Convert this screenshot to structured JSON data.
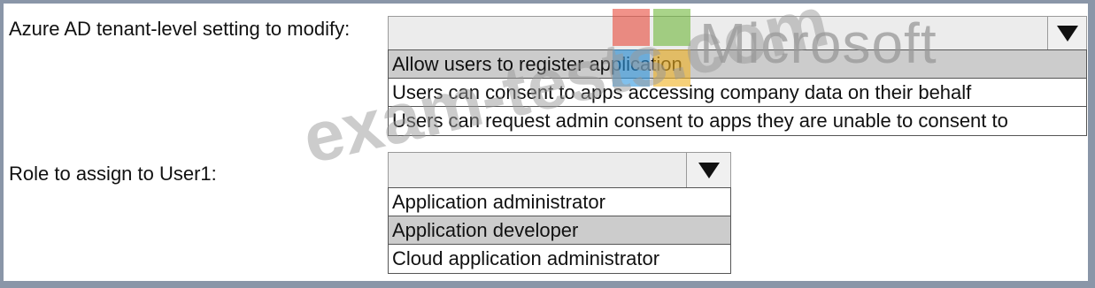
{
  "question1": {
    "label": "Azure AD tenant-level setting to modify:",
    "selected": "",
    "options": [
      "Allow users to register application",
      "Users can consent to apps accessing company data on their behalf",
      "Users can request admin consent to apps they are unable to consent to"
    ],
    "highlighted_index": 0
  },
  "question2": {
    "label": "Role to assign to User1:",
    "selected": "",
    "options": [
      "Application administrator",
      "Application developer",
      "Cloud application administrator"
    ],
    "highlighted_index": 1
  },
  "logo": {
    "text": "Microsoft",
    "colors": [
      "#e8493a",
      "#6fb83a",
      "#2d96e0",
      "#f0b020"
    ]
  },
  "watermark": {
    "text": "exam-tests.com"
  },
  "icons": {
    "dropdown_arrow": "triangle-down-icon"
  }
}
